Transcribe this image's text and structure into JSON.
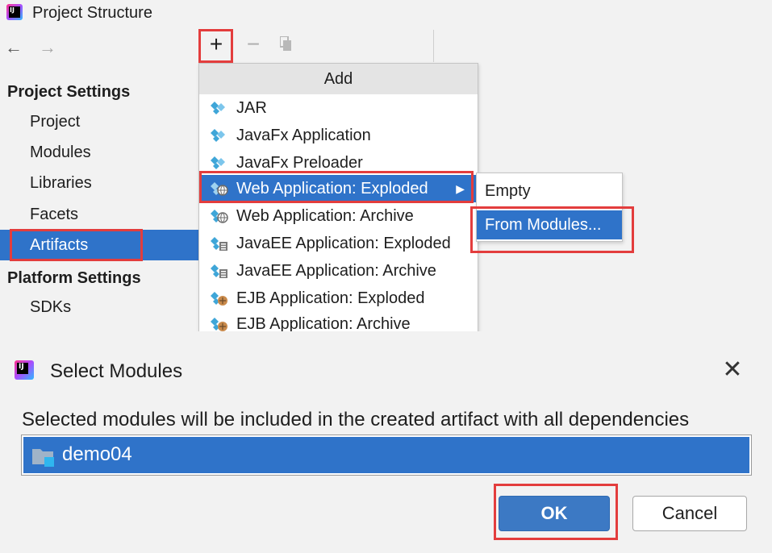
{
  "project_structure": {
    "title": "Project Structure",
    "nav": {
      "back": "←",
      "forward": "→"
    },
    "sections": [
      {
        "heading": "Project Settings",
        "items": [
          "Project",
          "Modules",
          "Libraries",
          "Facets",
          "Artifacts"
        ]
      },
      {
        "heading": "Platform Settings",
        "items": [
          "SDKs"
        ]
      }
    ],
    "selected_item": "Artifacts",
    "toolbar": {
      "add": "+",
      "remove": "−"
    }
  },
  "add_menu": {
    "header": "Add",
    "items": [
      {
        "label": "JAR",
        "icon": "artifact-icon"
      },
      {
        "label": "JavaFx Application",
        "icon": "artifact-icon"
      },
      {
        "label": "JavaFx Preloader",
        "icon": "artifact-icon"
      },
      {
        "label": "Web Application: Exploded",
        "icon": "web-artifact-icon",
        "selected": true,
        "has_submenu": true
      },
      {
        "label": "Web Application: Archive",
        "icon": "web-artifact-icon"
      },
      {
        "label": "JavaEE Application: Exploded",
        "icon": "javaee-artifact-icon"
      },
      {
        "label": "JavaEE Application: Archive",
        "icon": "javaee-artifact-icon"
      },
      {
        "label": "EJB Application: Exploded",
        "icon": "ejb-artifact-icon"
      },
      {
        "label": "EJB Application: Archive",
        "icon": "ejb-artifact-icon"
      }
    ],
    "submenu_arrow": "▶",
    "submenu": [
      "Empty",
      "From Modules..."
    ],
    "submenu_selected": "From Modules..."
  },
  "select_modules_dialog": {
    "title": "Select Modules",
    "close": "✕",
    "description": "Selected modules will be included in the created artifact with all dependencies",
    "modules": [
      {
        "name": "demo04",
        "selected": true
      }
    ],
    "ok_label": "OK",
    "cancel_label": "Cancel"
  },
  "colors": {
    "selection": "#2f73c9",
    "highlight_box": "#e33d3d",
    "panel_bg": "#f2f2f2"
  }
}
